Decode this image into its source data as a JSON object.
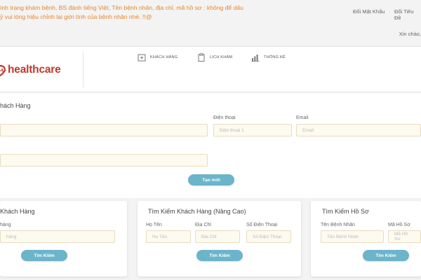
{
  "topbar": {
    "notice_line1": "ình trạng khám bệnh, BS đánh tiếng Việt, Tên bệnh nhân, địa chỉ, mã hồ sơ : không để dấu",
    "notice_line2": "ỷ vui lòng hiệu chỉnh lại giới tính của bệnh nhân nhé. !!@",
    "change_password": "Đổi Mật Khẩu",
    "change_title": "Đổi Tiêu Đề",
    "greeting": "Xin chào,"
  },
  "header": {
    "logo_text": "healthcare",
    "nav": [
      {
        "label": "KHÁCH HÀNG",
        "icon": "add-customer-icon"
      },
      {
        "label": "LỊCH KHÁM",
        "icon": "clipboard-icon"
      },
      {
        "label": "THỐNG KÊ",
        "icon": "bar-chart-icon"
      }
    ]
  },
  "create_form": {
    "title": "hách Hàng",
    "phone_label": "Điện thoại",
    "phone_placeholder": "Điện thoại 1",
    "email_label": "Email",
    "email_placeholder": "Email",
    "create_button": "Tạo mới"
  },
  "search_customer": {
    "title": "Khách Hàng",
    "name_label": "hàng",
    "name_placeholder": "hàng",
    "search_button": "Tìm Kiếm"
  },
  "advanced_search": {
    "title": "Tìm Kiếm Khách Hàng (Nâng Cao)",
    "name_label": "Họ Tên",
    "name_placeholder": "Họ Tên",
    "address_label": "Địa Chỉ",
    "address_placeholder": "Địa Chỉ",
    "phone_label": "Số Điện Thoại",
    "phone_placeholder": "Số Điện Thoại",
    "search_button": "Tìm Kiếm"
  },
  "record_search": {
    "title": "Tìm Kiếm Hồ Sơ",
    "patient_label": "Tên Bệnh Nhân",
    "patient_placeholder": "Tên Bệnh Nhân",
    "record_label": "Mã Hồ Sơ",
    "record_placeholder": "Mã Hồ Sơ",
    "search_button": "Tìm Kiếm"
  },
  "colors": {
    "notice": "#e8862a",
    "brand": "#c0392b",
    "button": "#6cb4ca",
    "input_bg": "#fdfaf0"
  }
}
